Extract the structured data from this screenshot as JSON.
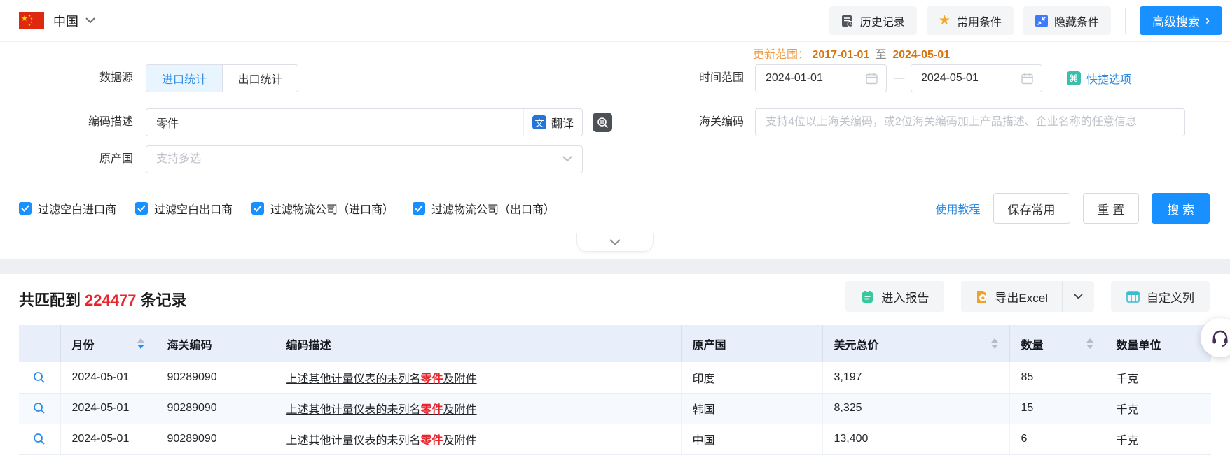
{
  "topbar": {
    "country": "中国",
    "history_label": "历史记录",
    "favorites_label": "常用条件",
    "favorites_icon": "★",
    "hide_label": "隐藏条件",
    "advanced_label": "高级搜索",
    "advanced_chevron": "›"
  },
  "form": {
    "update_range": {
      "label": "更新范围：",
      "from": "2017-01-01",
      "middle": "至",
      "to": "2024-05-01"
    },
    "data_source": {
      "label": "数据源",
      "import_tab": "进口统计",
      "export_tab": "出口统计"
    },
    "time_range": {
      "label": "时间范围",
      "start": "2024-01-01",
      "separator": "—",
      "end": "2024-05-01",
      "quick_label": "快捷选项",
      "quick_icon": "⌘"
    },
    "code_desc": {
      "label": "编码描述",
      "value": "零件",
      "translate_label": "翻译",
      "translate_icon": "文"
    },
    "hs_code": {
      "label": "海关编码",
      "placeholder": "支持4位以上海关编码，或2位海关编码加上产品描述、企业名称的任意信息"
    },
    "origin": {
      "label": "原产国",
      "placeholder": "支持多选"
    },
    "filters": [
      {
        "label": "过滤空白进口商",
        "checked": true
      },
      {
        "label": "过滤空白出口商",
        "checked": true
      },
      {
        "label": "过滤物流公司（进口商）",
        "checked": true
      },
      {
        "label": "过滤物流公司（出口商）",
        "checked": true
      }
    ],
    "actions": {
      "tutorial": "使用教程",
      "save": "保存常用",
      "reset": "重 置",
      "search": "搜 索"
    }
  },
  "results": {
    "summary": {
      "prefix": "共匹配到",
      "count": "224477",
      "suffix": "条记录"
    },
    "toolbar": {
      "report": "进入报告",
      "export": "导出Excel",
      "custom_columns": "自定义列"
    },
    "table": {
      "headers": {
        "month": "月份",
        "hs_code": "海关编码",
        "description": "编码描述",
        "origin": "原产国",
        "usd_total": "美元总价",
        "quantity": "数量",
        "unit": "数量单位"
      },
      "rows": [
        {
          "month": "2024-05-01",
          "hs_code": "90289090",
          "desc_prefix": "上述其他计量仪表的未列名",
          "desc_highlight": "零件",
          "desc_suffix": "及附件",
          "origin": "印度",
          "usd": "3,197",
          "qty": "85",
          "unit": "千克"
        },
        {
          "month": "2024-05-01",
          "hs_code": "90289090",
          "desc_prefix": "上述其他计量仪表的未列名",
          "desc_highlight": "零件",
          "desc_suffix": "及附件",
          "origin": "韩国",
          "usd": "8,325",
          "qty": "15",
          "unit": "千克"
        },
        {
          "month": "2024-05-01",
          "hs_code": "90289090",
          "desc_prefix": "上述其他计量仪表的未列名",
          "desc_highlight": "零件",
          "desc_suffix": "及附件",
          "origin": "中国",
          "usd": "13,400",
          "qty": "6",
          "unit": "千克"
        }
      ]
    }
  },
  "colors": {
    "accent": "#1890ff",
    "highlight_red": "#e8262d",
    "range_orange": "#d9730d"
  }
}
